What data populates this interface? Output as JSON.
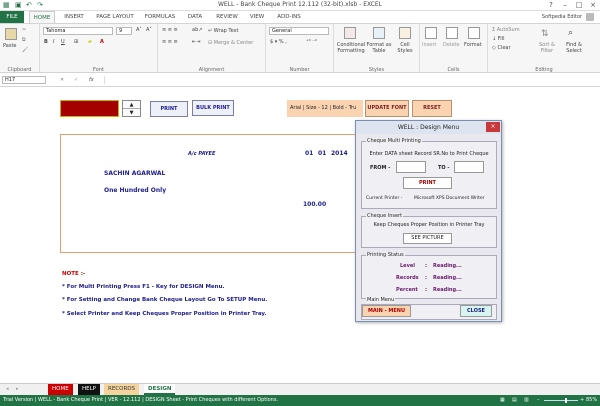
{
  "window": {
    "title": "WELL - Bank Cheque Print 12.112 (32-bit).xlsb - EXCEL",
    "user": "Softpedia Editor",
    "help": "?"
  },
  "ribbon_tabs": [
    "FILE",
    "HOME",
    "INSERT",
    "PAGE LAYOUT",
    "FORMULAS",
    "DATA",
    "REVIEW",
    "VIEW",
    "ADD-INS"
  ],
  "ribbon": {
    "paste": "Paste",
    "clipboard": "Clipboard",
    "font_name": "Tahoma",
    "font_size": "9",
    "font": "Font",
    "wrap": "Wrap Text",
    "merge": "Merge & Center",
    "alignment": "Alignment",
    "number_format": "General",
    "number": "Number",
    "cond": "Conditional",
    "cond2": "Formatting",
    "fmt_table": "Format as",
    "fmt_table2": "Table",
    "cell_styles": "Cell",
    "cell_styles2": "Styles",
    "styles": "Styles",
    "insert": "Insert",
    "delete": "Delete",
    "format": "Format",
    "cells": "Cells",
    "autosum": "AutoSum",
    "fill": "Fill",
    "clear": "Clear",
    "sort": "Sort &",
    "sort2": "Filter",
    "find": "Find &",
    "find2": "Select",
    "editing": "Editing"
  },
  "formula_bar": {
    "name_box": "H17",
    "fx": "fx"
  },
  "sheet": {
    "print_btn": "PRINT",
    "bulk_print_btn": "BULK PRINT",
    "font_info": "Arial | Size - 12 | Bold - Tru",
    "update_font_btn": "UPDATE FONT",
    "reset_btn": "RESET",
    "ac_payee": "A/c PAYEE",
    "date_d": "01",
    "date_m": "01",
    "date_y": "2014",
    "payee": "SACHIN AGARWAL",
    "amount_words": "One Hundred  Only",
    "amount": "100.00",
    "note_title": "NOTE :-",
    "notes": [
      "*  For Multi Printing Press F1 - Key for DESIGN Menu.",
      "*  For Setting and Change Bank Cheque Layout Go To SETUP Menu.",
      "*  Select Printer and Keep Cheques Proper Position in Printer Tray."
    ]
  },
  "dialog": {
    "title": "WELL : Design Menu",
    "close": "×",
    "multi_label": "Cheque Multi Printing",
    "multi_text": "Enter DATA sheet Record SR.No to Print Cheque",
    "from": "FROM -",
    "to": "TO -",
    "print": "PRINT",
    "printer_label": "Current Printer -",
    "printer_name": "Microsoft XPS Document Writer",
    "insert_label": "Cheque Insert",
    "insert_text": "Keep Cheques Proper Position in Printer Tray",
    "see_picture": "SEE PICTURE",
    "status_label": "Printing Status",
    "level": "Level",
    "records": "Records",
    "percent": "Percent",
    "colon": ":",
    "reading": "Reading...",
    "main_label": "Main Menu",
    "main_menu_btn": "MAIN - MENU",
    "close_btn": "CLOSE"
  },
  "sheet_tabs": [
    "HOME",
    "HELP",
    "RECORDS",
    "DESIGN"
  ],
  "status_bar": {
    "text": "Trial Version  |  WELL - Bank Cheque Print  |  VER - 12.112  |  DESIGN Sheet - Print Cheques with different Options.",
    "zoom": "85%"
  }
}
